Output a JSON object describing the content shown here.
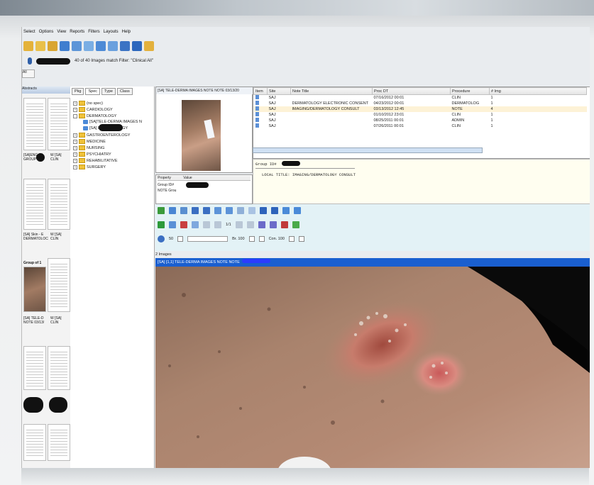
{
  "menu": [
    "Select",
    "Options",
    "View",
    "Reports",
    "Filters",
    "Layouts",
    "Help"
  ],
  "filter": {
    "status_text": "40 of 40 Images match Filter: \"Clinical All\""
  },
  "side_button_label": "All",
  "thumb_header": "Abstracts",
  "tree": {
    "tabs": [
      "Pkg",
      "Spec",
      "Type",
      "Class"
    ],
    "items": [
      {
        "label": "(no spec)",
        "level": 0
      },
      {
        "label": "CARDIOLOGY",
        "level": 0
      },
      {
        "label": "DERMATOLOGY",
        "level": 0
      },
      {
        "label": "[SA]TELE-DERMA IMAGES N",
        "level": 2
      },
      {
        "label": "[SA]      DERMATOLOGY",
        "level": 2
      },
      {
        "label": "GASTROENTEROLOGY",
        "level": 0
      },
      {
        "label": "MEDICINE",
        "level": 0
      },
      {
        "label": "NURSING",
        "level": 0
      },
      {
        "label": "PSYCHIATRY",
        "level": 0
      },
      {
        "label": "REHABILITATIVE",
        "level": 0
      },
      {
        "label": "SURGERY",
        "level": 0
      }
    ]
  },
  "thumb_labels": [
    {
      "left": "[SA]ENG-DI\nGROUP C",
      "right": "W [SA]\nCLIN"
    },
    {
      "left": "[SA] Skin - E\nDERMATOLOC",
      "right": "W [SA]\nCLIN"
    },
    {
      "left": "Group of 1",
      "right": ""
    },
    {
      "left": "[SA] TELE-D\nNOTE 03/13/",
      "right": "W [SA]\nCLIN"
    }
  ],
  "preview": {
    "title": "[SA] TELE-DERMA IMAGES NOTE NOTE 03/13/20"
  },
  "properties": {
    "col_property": "Property",
    "col_value": "Value",
    "rows": [
      "Group ID#",
      "NOTE Grou"
    ]
  },
  "grid": {
    "columns": [
      "Item",
      "Site",
      "Note Title",
      "Proc DT",
      "Procedure",
      "# Img"
    ],
    "rows": [
      {
        "site": "SAJ",
        "title": "",
        "date": "07/16/2012 00:01",
        "proc": "CLIN",
        "img": "1",
        "sel": false
      },
      {
        "site": "SAJ",
        "title": "DERMATOLOGY ELECTRONIC CONSENT",
        "date": "04/23/2012 00:01",
        "proc": "DERMATOLOG",
        "img": "1",
        "sel": false
      },
      {
        "site": "SAJ",
        "title": "IMAGING/DERMATOLOGY CONSULT",
        "date": "03/13/2012 12:45",
        "proc": "NOTE",
        "img": "4",
        "sel": true
      },
      {
        "site": "SAJ",
        "title": "",
        "date": "01/10/2012 23:01",
        "proc": "CLIN",
        "img": "1",
        "sel": false
      },
      {
        "site": "SAJ",
        "title": "",
        "date": "08/25/2011 00:01",
        "proc": "ADMIN",
        "img": "1",
        "sel": false
      },
      {
        "site": "SAJ",
        "title": "",
        "date": "07/26/2011 00:01",
        "proc": "CLIN",
        "img": "1",
        "sel": false
      }
    ]
  },
  "report": {
    "header": "Group ID#",
    "local_title": "LOCAL TITLE: IMAGING/DERMATOLOGY CONSULT"
  },
  "viewer_controls": {
    "zoom_value": "50",
    "brightness_label": "Br. 100",
    "contrast_label": "Con. 100",
    "page_value": "1/1"
  },
  "image_count": "2 Images",
  "viewer_title": "[SA] [1,1] TELE-DERMA IMAGES NOTE NOTE",
  "colors": {
    "accent_blue": "#1a5fd0",
    "folder": "#f0c23a",
    "selection": "#fdf2d6"
  }
}
